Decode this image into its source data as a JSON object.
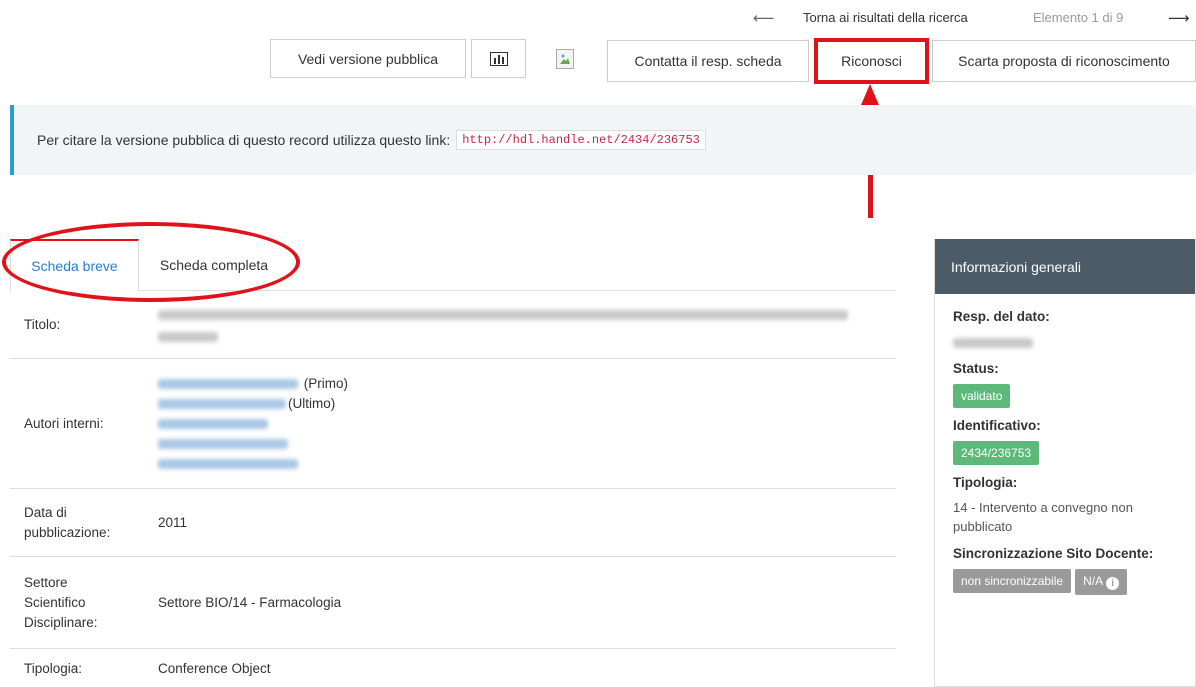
{
  "topnav": {
    "back_arrow": "⟵",
    "back_label": "Torna ai risultati della ricerca",
    "counter": "Elemento 1 di 9",
    "next_arrow": "⟶"
  },
  "toolbar": {
    "public_version_label": "Vedi versione pubblica",
    "chart_icon": "bar-chart-icon",
    "broken_image_icon": "broken-image-icon",
    "contact_label": "Contatta il resp. scheda",
    "recognize_label": "Riconosci",
    "discard_label": "Scarta proposta di riconoscimento"
  },
  "citation": {
    "text": "Per citare la versione pubblica di questo record utilizza questo link:",
    "link": "http://hdl.handle.net/2434/236753"
  },
  "tabs": [
    {
      "label": "Scheda breve",
      "active": true
    },
    {
      "label": "Scheda completa",
      "active": false
    }
  ],
  "details": {
    "title_label": "Titolo:",
    "authors_label": "Autori interni:",
    "author_roles": [
      "(Primo)",
      "(Ultimo)"
    ],
    "date_label_1": "Data di",
    "date_label_2": "pubblicazione:",
    "date_value": "2011",
    "ssd_label_1": "Settore",
    "ssd_label_2": "Scientifico",
    "ssd_label_3": "Disciplinare:",
    "ssd_value": "Settore BIO/14 - Farmacologia",
    "type_label": "Tipologia:",
    "type_value": "Conference Object"
  },
  "sidebar": {
    "header": "Informazioni generali",
    "resp_label": "Resp. del dato:",
    "status_label": "Status:",
    "status_value": "validato",
    "id_label": "Identificativo:",
    "id_value": "2434/236753",
    "type_label": "Tipologia:",
    "type_value": "14 - Intervento a convegno non pubblicato",
    "sync_label": "Sincronizzazione Sito Docente:",
    "sync_value": "non sincronizzabile",
    "na_label": "N/A",
    "info_icon": "i"
  },
  "colors": {
    "annotation_red": "#e0131a",
    "accent_blue": "#2a9bd6",
    "badge_green": "#5cb97a",
    "sidebar_header": "#4b5b67"
  }
}
